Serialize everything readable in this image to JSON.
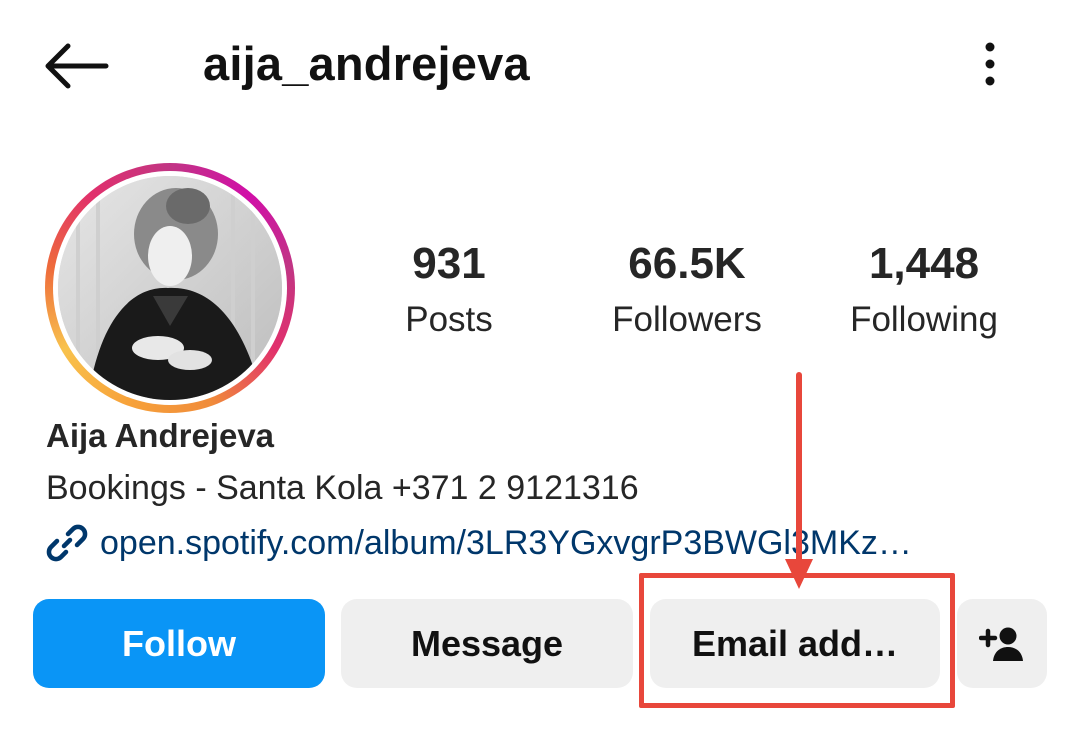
{
  "header": {
    "username": "aija_andrejeva",
    "back_icon": "arrow-left-icon",
    "more_icon": "more-vertical-icon"
  },
  "profile": {
    "avatar_alt": "profile photo",
    "stats": [
      {
        "value": "931",
        "label": "Posts"
      },
      {
        "value": "66.5K",
        "label": "Followers"
      },
      {
        "value": "1,448",
        "label": "Following"
      }
    ],
    "full_name": "Aija Andrejeva",
    "bio": "Bookings - Santa Kola +371 2 9121316",
    "link": {
      "icon": "link-icon",
      "text": "open.spotify.com/album/3LR3YGxvgrP3BWGl3MKz…"
    }
  },
  "actions": {
    "follow": "Follow",
    "message": "Message",
    "email": "Email add…",
    "add_user_icon": "add-person-icon"
  },
  "colors": {
    "follow_bg": "#0a95f6",
    "button_bg": "#efefef",
    "link": "#00376b",
    "annotation": "#e8473b"
  }
}
